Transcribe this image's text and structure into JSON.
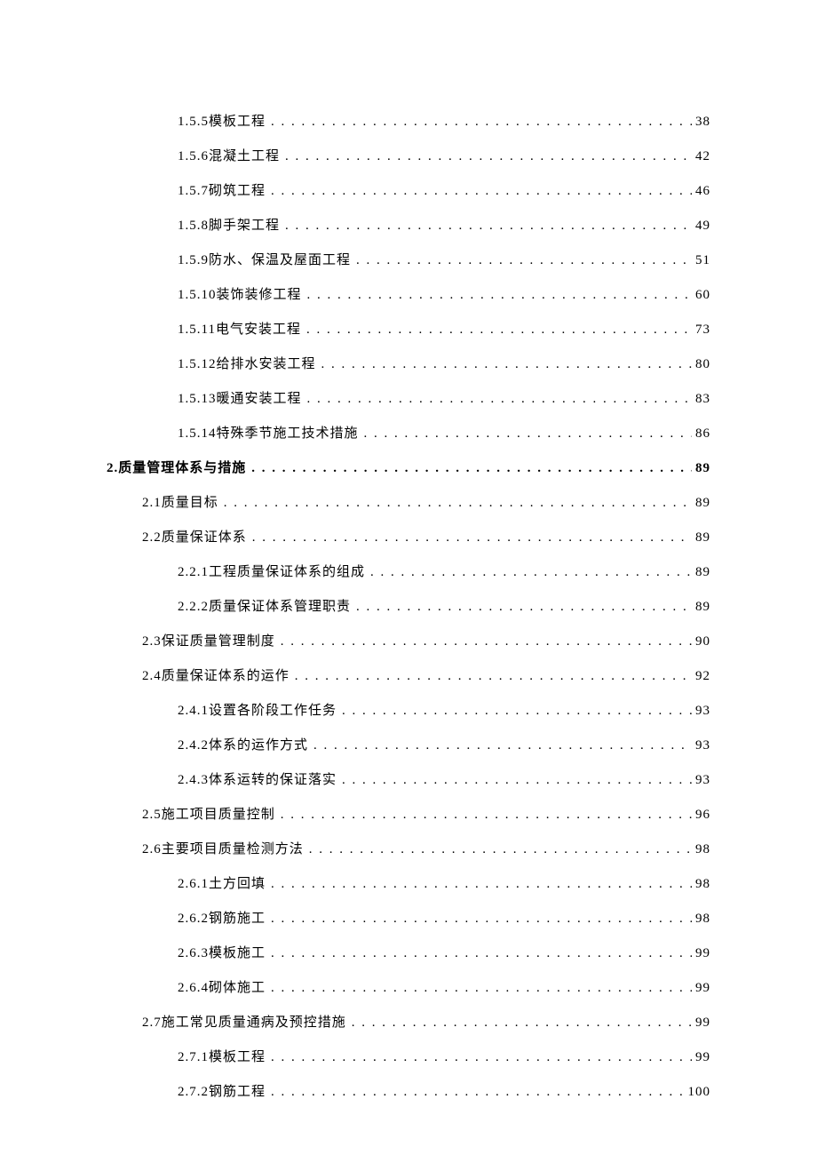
{
  "toc": [
    {
      "level": 3,
      "num": "1.5.5",
      "title": "模板工程",
      "page": "38"
    },
    {
      "level": 3,
      "num": "1.5.6",
      "title": "混凝土工程",
      "page": "42"
    },
    {
      "level": 3,
      "num": "1.5.7",
      "title": "砌筑工程",
      "page": "46"
    },
    {
      "level": 3,
      "num": "1.5.8",
      "title": "脚手架工程",
      "page": "49"
    },
    {
      "level": 3,
      "num": "1.5.9",
      "title": "防水、保温及屋面工程",
      "page": "51"
    },
    {
      "level": 3,
      "num": "1.5.10",
      "title": "装饰装修工程",
      "page": "60"
    },
    {
      "level": 3,
      "num": "1.5.11",
      "title": "电气安装工程",
      "page": "73"
    },
    {
      "level": 3,
      "num": "1.5.12",
      "title": "给排水安装工程",
      "page": "80"
    },
    {
      "level": 3,
      "num": "1.5.13",
      "title": "暖通安装工程",
      "page": "83"
    },
    {
      "level": 3,
      "num": "1.5.14",
      "title": "特殊季节施工技术措施",
      "page": "86"
    },
    {
      "level": 1,
      "num": "2.",
      "title": "质量管理体系与措施",
      "page": "89"
    },
    {
      "level": 2,
      "num": "2.1",
      "title": "质量目标",
      "page": "89"
    },
    {
      "level": 2,
      "num": "2.2",
      "title": "质量保证体系",
      "page": "89"
    },
    {
      "level": 3,
      "num": "2.2.1",
      "title": "工程质量保证体系的组成",
      "page": "89"
    },
    {
      "level": 3,
      "num": "2.2.2",
      "title": "质量保证体系管理职责",
      "page": "89"
    },
    {
      "level": 2,
      "num": "2.3",
      "title": "保证质量管理制度",
      "page": "90"
    },
    {
      "level": 2,
      "num": "2.4",
      "title": "质量保证体系的运作",
      "page": "92"
    },
    {
      "level": 3,
      "num": "2.4.1",
      "title": "设置各阶段工作任务",
      "page": "93"
    },
    {
      "level": 3,
      "num": "2.4.2",
      "title": "体系的运作方式",
      "page": "93"
    },
    {
      "level": 3,
      "num": "2.4.3",
      "title": "体系运转的保证落实",
      "page": "93"
    },
    {
      "level": 2,
      "num": "2.5",
      "title": "施工项目质量控制",
      "page": "96"
    },
    {
      "level": 2,
      "num": "2.6",
      "title": "主要项目质量检测方法",
      "page": "98"
    },
    {
      "level": 3,
      "num": "2.6.1",
      "title": "土方回填",
      "page": "98"
    },
    {
      "level": 3,
      "num": "2.6.2",
      "title": "钢筋施工",
      "page": "98"
    },
    {
      "level": 3,
      "num": "2.6.3",
      "title": "模板施工",
      "page": "99"
    },
    {
      "level": 3,
      "num": "2.6.4",
      "title": "砌体施工",
      "page": "99"
    },
    {
      "level": 2,
      "num": "2.7",
      "title": "施工常见质量通病及预控措施",
      "page": "99"
    },
    {
      "level": 3,
      "num": "2.7.1",
      "title": "模板工程",
      "page": "99"
    },
    {
      "level": 3,
      "num": "2.7.2",
      "title": "钢筋工程",
      "page": "100"
    }
  ]
}
